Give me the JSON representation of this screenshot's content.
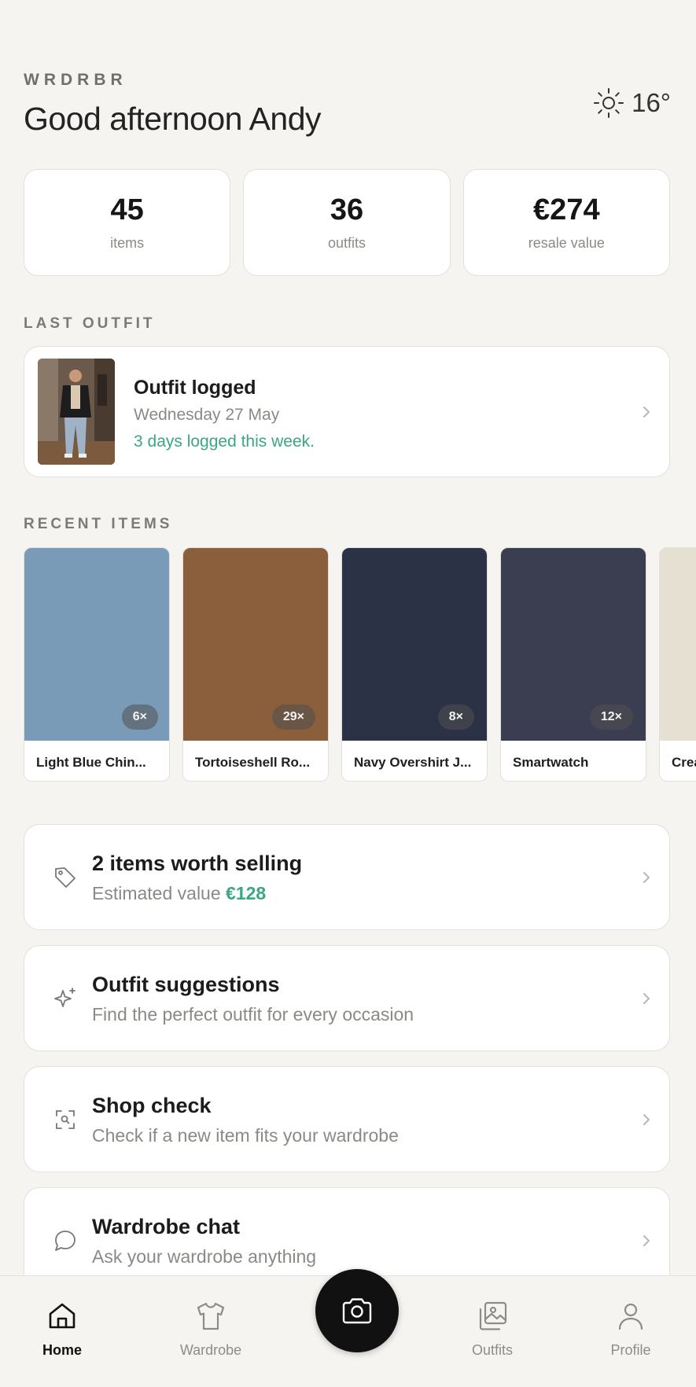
{
  "header": {
    "brand": "WRDRBR",
    "greeting": "Good afternoon Andy",
    "weather_icon": "sun-icon",
    "temperature": "16°"
  },
  "stats": [
    {
      "value": "45",
      "label": "items"
    },
    {
      "value": "36",
      "label": "outfits"
    },
    {
      "value": "€274",
      "label": "resale value"
    }
  ],
  "last_outfit": {
    "section_label": "LAST OUTFIT",
    "title": "Outfit logged",
    "date": "Wednesday 27 May",
    "streak": "3 days logged this week."
  },
  "recent_items": {
    "section_label": "RECENT ITEMS",
    "items": [
      {
        "name": "Light Blue Chin...",
        "wears": "6×",
        "color": "#7a9bb7"
      },
      {
        "name": "Tortoiseshell Ro...",
        "wears": "29×",
        "color": "#8b5e3c"
      },
      {
        "name": "Navy Overshirt J...",
        "wears": "8×",
        "color": "#2b3245"
      },
      {
        "name": "Smartwatch",
        "wears": "12×",
        "color": "#3b3d50"
      },
      {
        "name": "Crea",
        "wears": "",
        "color": "#e6e0d3"
      }
    ]
  },
  "cards": [
    {
      "icon": "tag-icon",
      "title": "2 items worth selling",
      "subtitle": "Estimated value ",
      "value": "€128"
    },
    {
      "icon": "sparkle-icon",
      "title": "Outfit suggestions",
      "subtitle": "Find the perfect outfit for every occasion"
    },
    {
      "icon": "scan-icon",
      "title": "Shop check",
      "subtitle": "Check if a new item fits your wardrobe"
    },
    {
      "icon": "chat-icon",
      "title": "Wardrobe chat",
      "subtitle": "Ask your wardrobe anything"
    }
  ],
  "nav": {
    "items": [
      {
        "label": "Home",
        "icon": "home-icon",
        "active": true
      },
      {
        "label": "Wardrobe",
        "icon": "shirt-icon"
      },
      {
        "label": "Outfits",
        "icon": "images-icon"
      },
      {
        "label": "Profile",
        "icon": "user-icon"
      }
    ],
    "camera_icon": "camera-icon"
  },
  "colors": {
    "background": "#f5f4f0",
    "accent_green": "#3aa784",
    "card_border": "#e1e0da"
  }
}
